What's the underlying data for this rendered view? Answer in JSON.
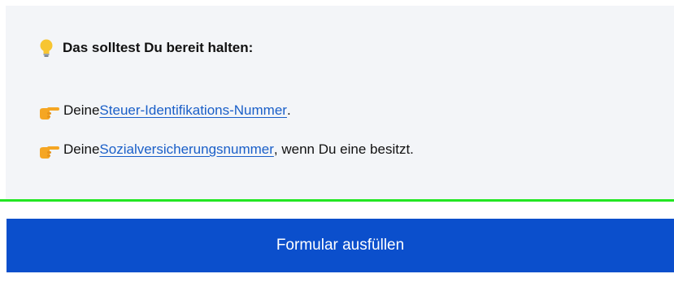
{
  "info": {
    "heading": "Das solltest Du bereit halten:",
    "heading_icon": "lightbulb-icon",
    "items": [
      {
        "icon": "pointing-hand-icon",
        "prefix": "Deine ",
        "link": "Steuer-Identifikations-Nummer",
        "suffix": "."
      },
      {
        "icon": "pointing-hand-icon",
        "prefix": "Deine ",
        "link": "Sozialversicherungsnummer",
        "suffix": ", wenn Du eine besitzt."
      }
    ]
  },
  "action": {
    "button_label": "Formular ausfüllen"
  },
  "colors": {
    "box_background": "#f3f5f8",
    "link": "#1a5fc8",
    "divider": "#22e622",
    "button": "#0b4fcc"
  }
}
